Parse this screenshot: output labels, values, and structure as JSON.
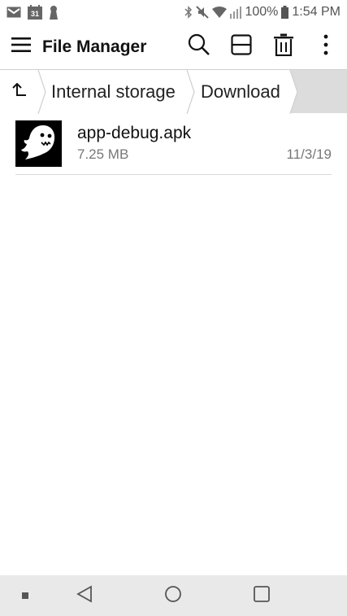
{
  "status_bar": {
    "icons_left": [
      "gmail-icon",
      "calendar-icon",
      "keyhole-icon"
    ],
    "calendar_day": "31",
    "icons_right": [
      "bluetooth-icon",
      "mute-icon",
      "wifi-icon",
      "signal-icon",
      "battery-icon"
    ],
    "battery": "100%",
    "time": "1:54 PM"
  },
  "app_bar": {
    "title": "File Manager",
    "actions": [
      "search-icon",
      "split-view-icon",
      "delete-icon",
      "more-options-icon"
    ]
  },
  "breadcrumb": {
    "up_icon": "up-arrow-icon",
    "items": [
      {
        "label": "Internal storage"
      },
      {
        "label": "Download"
      }
    ]
  },
  "files": [
    {
      "name": "app-debug.apk",
      "size": "7.25 MB",
      "date": "11/3/19",
      "thumb_icon": "ghost-icon"
    }
  ],
  "nav_bar": {
    "buttons": [
      "dot-icon",
      "back-icon",
      "home-icon",
      "recents-icon"
    ]
  },
  "colors": {
    "breadcrumb_bg": "#dcdcdc",
    "nav_bar_bg": "#e9e9ea",
    "secondary_text": "#777777"
  }
}
